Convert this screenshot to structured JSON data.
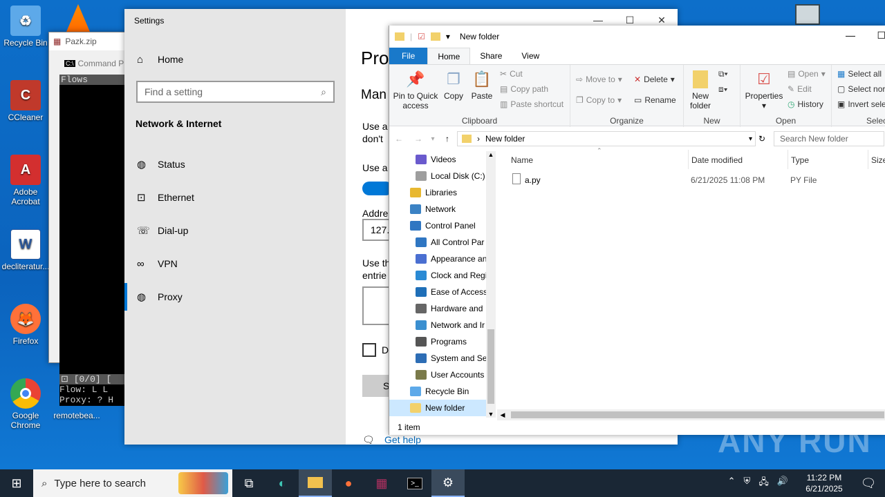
{
  "desktop": {
    "icons": [
      {
        "label": "Recycle Bin",
        "icon": "recycle-bin-icon",
        "color": "#5da9e9"
      },
      {
        "label": "CCleaner",
        "icon": "ccleaner-icon",
        "color": "#c0392b"
      },
      {
        "label": "Adobe Acrobat",
        "icon": "acrobat-icon",
        "color": "#d32f2f"
      },
      {
        "label": "decliteratur...",
        "icon": "word-doc-icon",
        "color": "#2b579a"
      },
      {
        "label": "Firefox",
        "icon": "firefox-icon",
        "color": "#ff7139"
      },
      {
        "label": "Google Chrome",
        "icon": "chrome-icon",
        "color": "#34a853"
      },
      {
        "label": "remotebea...",
        "icon": "file-icon",
        "color": "#888888"
      }
    ]
  },
  "winrar": {
    "title": "Pazk.zip"
  },
  "cmd": {
    "title": "Command P",
    "lines": [
      "Flows"
    ],
    "bottom_lines": [
      "⊡ [0/0]  [",
      "Flow:   L L",
      "Proxy:  ? H"
    ]
  },
  "settings": {
    "title": "Settings",
    "home": "Home",
    "search_placeholder": "Find a setting",
    "section": "Network & Internet",
    "nav": [
      {
        "label": "Status",
        "icon": "globe-icon"
      },
      {
        "label": "Ethernet",
        "icon": "ethernet-icon"
      },
      {
        "label": "Dial-up",
        "icon": "dialup-icon"
      },
      {
        "label": "VPN",
        "icon": "vpn-icon"
      },
      {
        "label": "Proxy",
        "icon": "globe-icon"
      }
    ],
    "content": {
      "heading": "Pro",
      "subheading": "Man",
      "text1a": "Use a",
      "text1b": "don't",
      "text2": "Use a",
      "address_label": "Addre",
      "address_value": "127.",
      "text3a": "Use th",
      "text3b": "entrie",
      "checkbox_label": "D",
      "save_label": "S",
      "get_help": "Get help"
    }
  },
  "explorer": {
    "title": "New folder",
    "tabs": [
      "File",
      "Home",
      "Share",
      "View"
    ],
    "ribbon": {
      "clipboard": {
        "label": "Clipboard",
        "pin": "Pin to Quick access",
        "copy": "Copy",
        "paste": "Paste",
        "cut": "Cut",
        "copy_path": "Copy path",
        "paste_shortcut": "Paste shortcut"
      },
      "organize": {
        "label": "Organize",
        "move_to": "Move to",
        "copy_to": "Copy to",
        "delete": "Delete",
        "rename": "Rename"
      },
      "new": {
        "label": "New",
        "new_folder": "New folder"
      },
      "open": {
        "label": "Open",
        "properties": "Properties",
        "open": "Open",
        "edit": "Edit",
        "history": "History"
      },
      "select": {
        "label": "Select",
        "select_all": "Select all",
        "select_none": "Select nor",
        "invert": "Invert sele"
      }
    },
    "address": "New folder",
    "search_placeholder": "Search New folder",
    "tree": [
      {
        "label": "Videos",
        "indent": 1,
        "color": "#6a5acd"
      },
      {
        "label": "Local Disk (C:)",
        "indent": 1,
        "color": "#9e9e9e"
      },
      {
        "label": "Libraries",
        "indent": 0,
        "color": "#e8b830"
      },
      {
        "label": "Network",
        "indent": 0,
        "color": "#3b82c4"
      },
      {
        "label": "Control Panel",
        "indent": 0,
        "color": "#2f76c2"
      },
      {
        "label": "All Control Par",
        "indent": 1,
        "color": "#2f76c2"
      },
      {
        "label": "Appearance an",
        "indent": 1,
        "color": "#4a6fd1"
      },
      {
        "label": "Clock and Regi",
        "indent": 1,
        "color": "#2a8ad4"
      },
      {
        "label": "Ease of Access",
        "indent": 1,
        "color": "#1f6fb8"
      },
      {
        "label": "Hardware and",
        "indent": 1,
        "color": "#666666"
      },
      {
        "label": "Network and Ir",
        "indent": 1,
        "color": "#3a8fd0"
      },
      {
        "label": "Programs",
        "indent": 1,
        "color": "#555555"
      },
      {
        "label": "System and Se",
        "indent": 1,
        "color": "#2d6db5"
      },
      {
        "label": "User Accounts",
        "indent": 1,
        "color": "#7a7a4a"
      },
      {
        "label": "Recycle Bin",
        "indent": 0,
        "color": "#5da9e9"
      },
      {
        "label": "New folder",
        "indent": 0,
        "color": "#f2d16b"
      }
    ],
    "columns": [
      "Name",
      "Date modified",
      "Type",
      "Size"
    ],
    "files": [
      {
        "name": "a.py",
        "date": "6/21/2025 11:08 PM",
        "type": "PY File"
      }
    ],
    "status": "1 item"
  },
  "taskbar": {
    "search_placeholder": "Type here to search",
    "time": "11:22 PM",
    "date": "6/21/2025"
  },
  "watermark": "ANY RUN"
}
